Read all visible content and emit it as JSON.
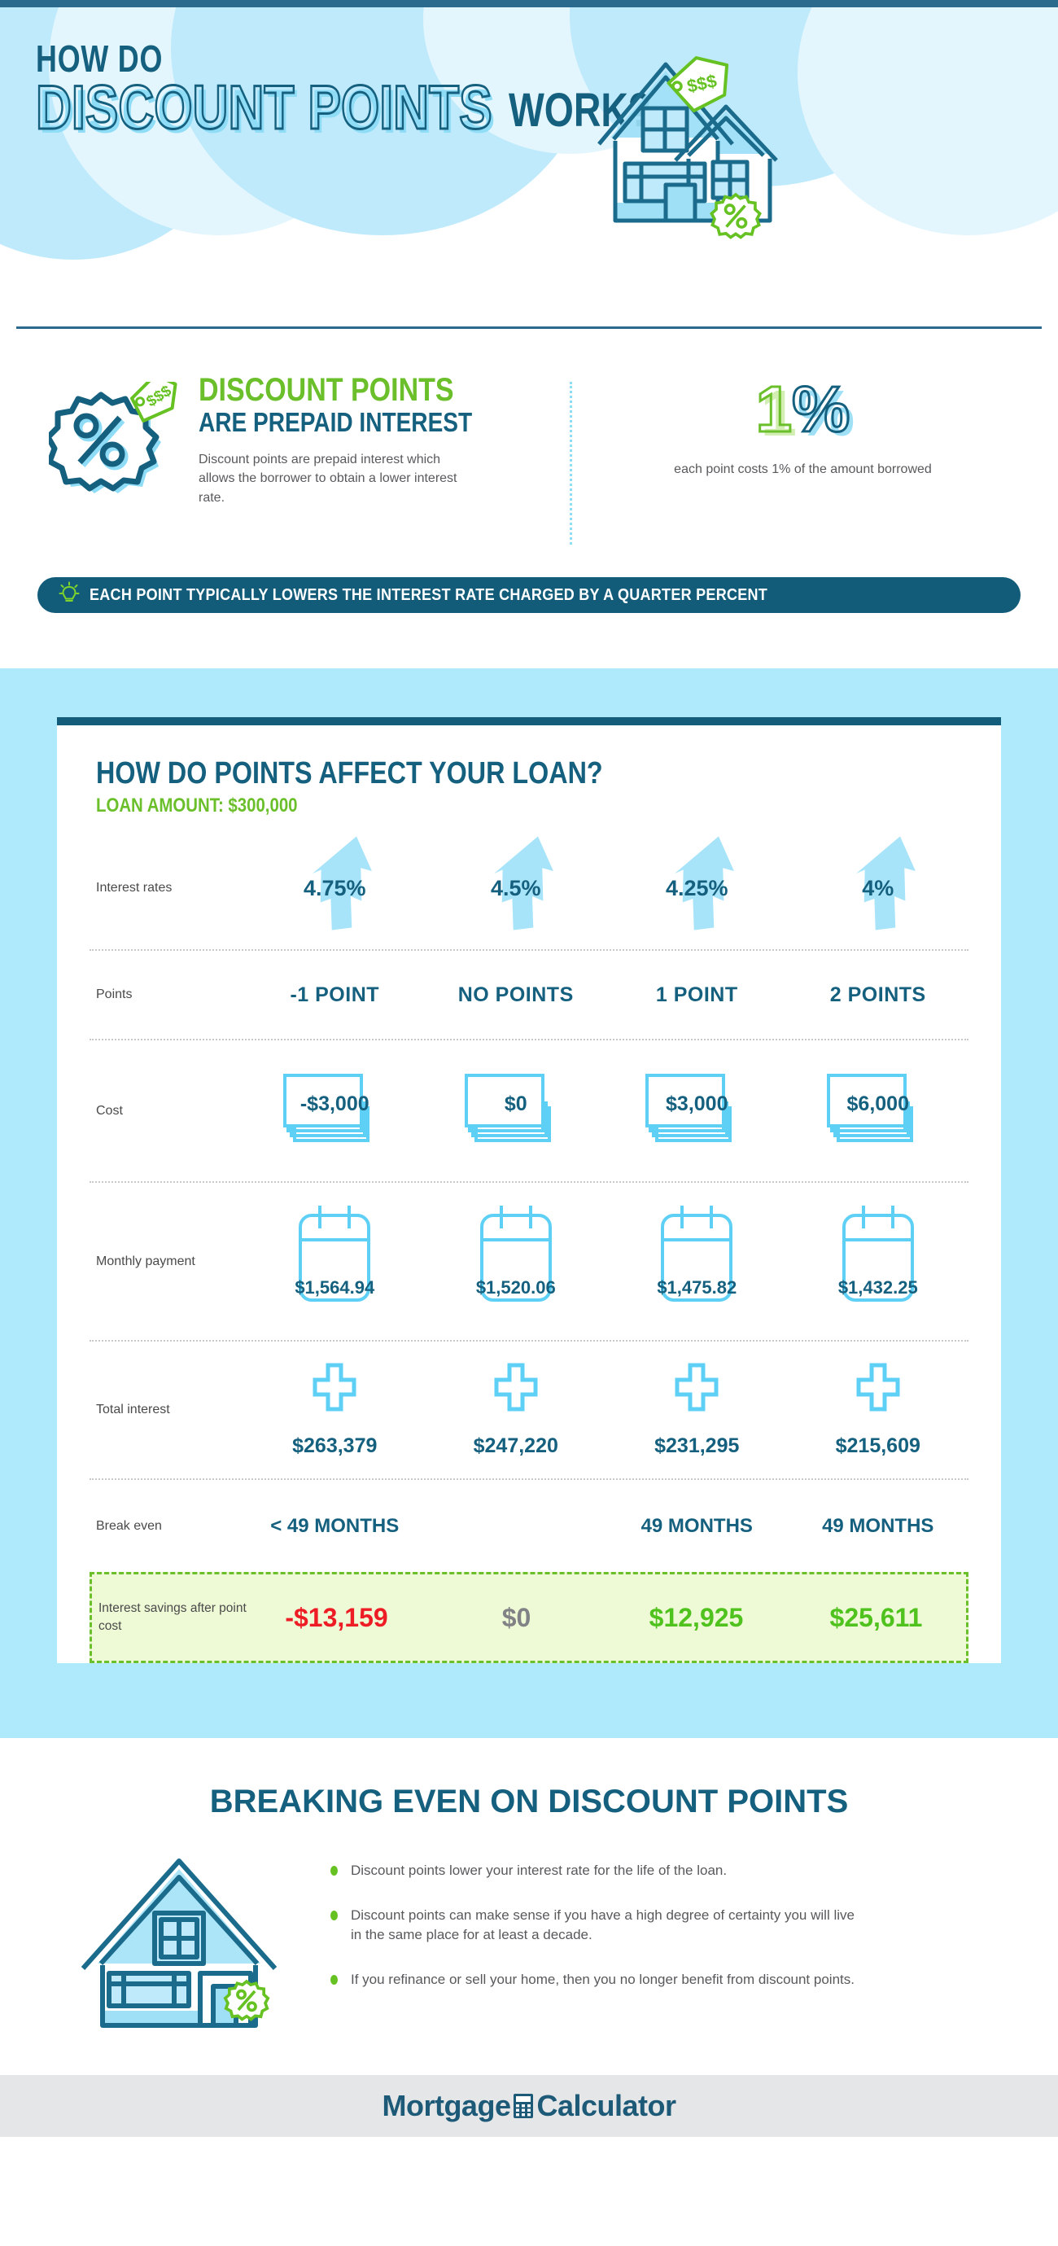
{
  "hero": {
    "line1": "HOW DO",
    "line2": "DISCOUNT POINTS",
    "line3": "WORK?",
    "house_icon": "house-with-price-tag-icon",
    "percent_badge_icon": "percent-seal-icon"
  },
  "intro": {
    "badge_icon": "percent-seal-with-dollar-tag-icon",
    "heading_green": "DISCOUNT POINTS",
    "heading_blue": "ARE PREPAID INTEREST",
    "paragraph": "Discount points are prepaid interest which allows the borrower to obtain a lower interest rate.",
    "stat_number_green": "1",
    "stat_number_symbol": "%",
    "stat_caption": "each point costs 1% of the amount borrowed"
  },
  "banner": {
    "icon": "lightbulb-icon",
    "text": "EACH POINT TYPICALLY LOWERS THE INTEREST RATE CHARGED BY A QUARTER PERCENT"
  },
  "table": {
    "title": "HOW DO POINTS AFFECT YOUR LOAN?",
    "subtitle": "LOAN AMOUNT: $300,000",
    "rows": {
      "interest_rates": {
        "label": "Interest rates",
        "icon": "up-arrow-icon",
        "values": [
          "4.75%",
          "4.5%",
          "4.25%",
          "4%"
        ]
      },
      "points": {
        "label": "Points",
        "values": [
          "-1 POINT",
          "NO POINTS",
          "1 POINT",
          "2 POINTS"
        ]
      },
      "cost": {
        "label": "Cost",
        "icon": "cash-stack-icon",
        "values": [
          "-$3,000",
          "$0",
          "$3,000",
          "$6,000"
        ]
      },
      "monthly_payment": {
        "label": "Monthly payment",
        "icon": "calendar-icon",
        "values": [
          "$1,564.94",
          "$1,520.06",
          "$1,475.82",
          "$1,432.25"
        ]
      },
      "total_interest": {
        "label": "Total interest",
        "icon": "plus-icon",
        "values": [
          "$263,379",
          "$247,220",
          "$231,295",
          "$215,609"
        ]
      },
      "break_even": {
        "label": "Break even",
        "values": [
          "< 49 MONTHS",
          "",
          "49 MONTHS",
          "49 MONTHS"
        ]
      },
      "interest_savings": {
        "label": "Interest savings after point cost",
        "values": [
          "-$13,159",
          "$0",
          "$12,925",
          "$25,611"
        ]
      }
    }
  },
  "breaking_even": {
    "title": "BREAKING EVEN ON DISCOUNT POINTS",
    "house_icon": "house-with-percent-seal-icon",
    "bullets": [
      "Discount points lower your interest rate for the life of the loan.",
      "Discount points can make sense if you have a high degree of certainty you will live in the same place for at least a decade.",
      "If you refinance or sell your home, then you no longer benefit from discount points."
    ]
  },
  "footer": {
    "logo_part1": "Mortgage",
    "logo_icon": "calculator-icon",
    "logo_part2": "Calculator"
  },
  "colors": {
    "dark_blue": "#15607e",
    "light_blue": "#aeeafb",
    "sky_blue": "#8fdcf7",
    "green": "#6abf2a",
    "bright_green": "#4fc21e",
    "red": "#ee1c25",
    "grey_text": "#58595b",
    "savings_bg": "#eef9d5",
    "footer_bg": "#e5e6e8"
  }
}
